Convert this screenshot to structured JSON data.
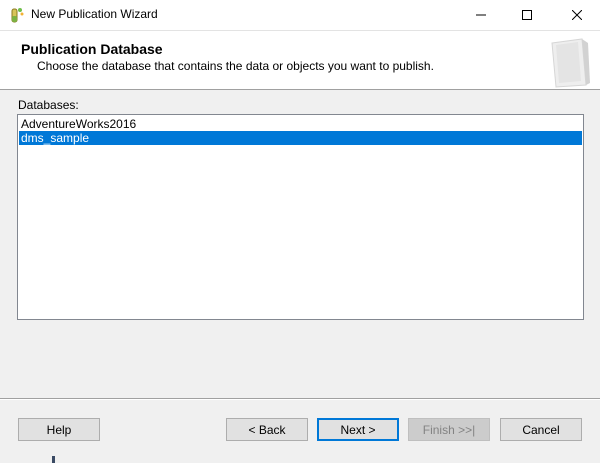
{
  "window": {
    "title": "New Publication Wizard",
    "app_icon": "wizard-tube-icon",
    "controls": {
      "minimize": "minimize-icon",
      "maximize": "maximize-icon",
      "close": "close-icon"
    }
  },
  "header": {
    "title": "Publication Database",
    "description": "Choose the database that contains the data or objects you want to publish.",
    "graphic": "wizard-page-graphic"
  },
  "databases": {
    "label": "Databases:",
    "items": [
      "AdventureWorks2016",
      "dms_sample"
    ],
    "selected_index": 1
  },
  "buttons": {
    "help": "Help",
    "back": "< Back",
    "next": "Next >",
    "finish": "Finish >>|",
    "cancel": "Cancel"
  },
  "colors": {
    "selection": "#0078d7",
    "window_bg": "#f0f0f0"
  }
}
